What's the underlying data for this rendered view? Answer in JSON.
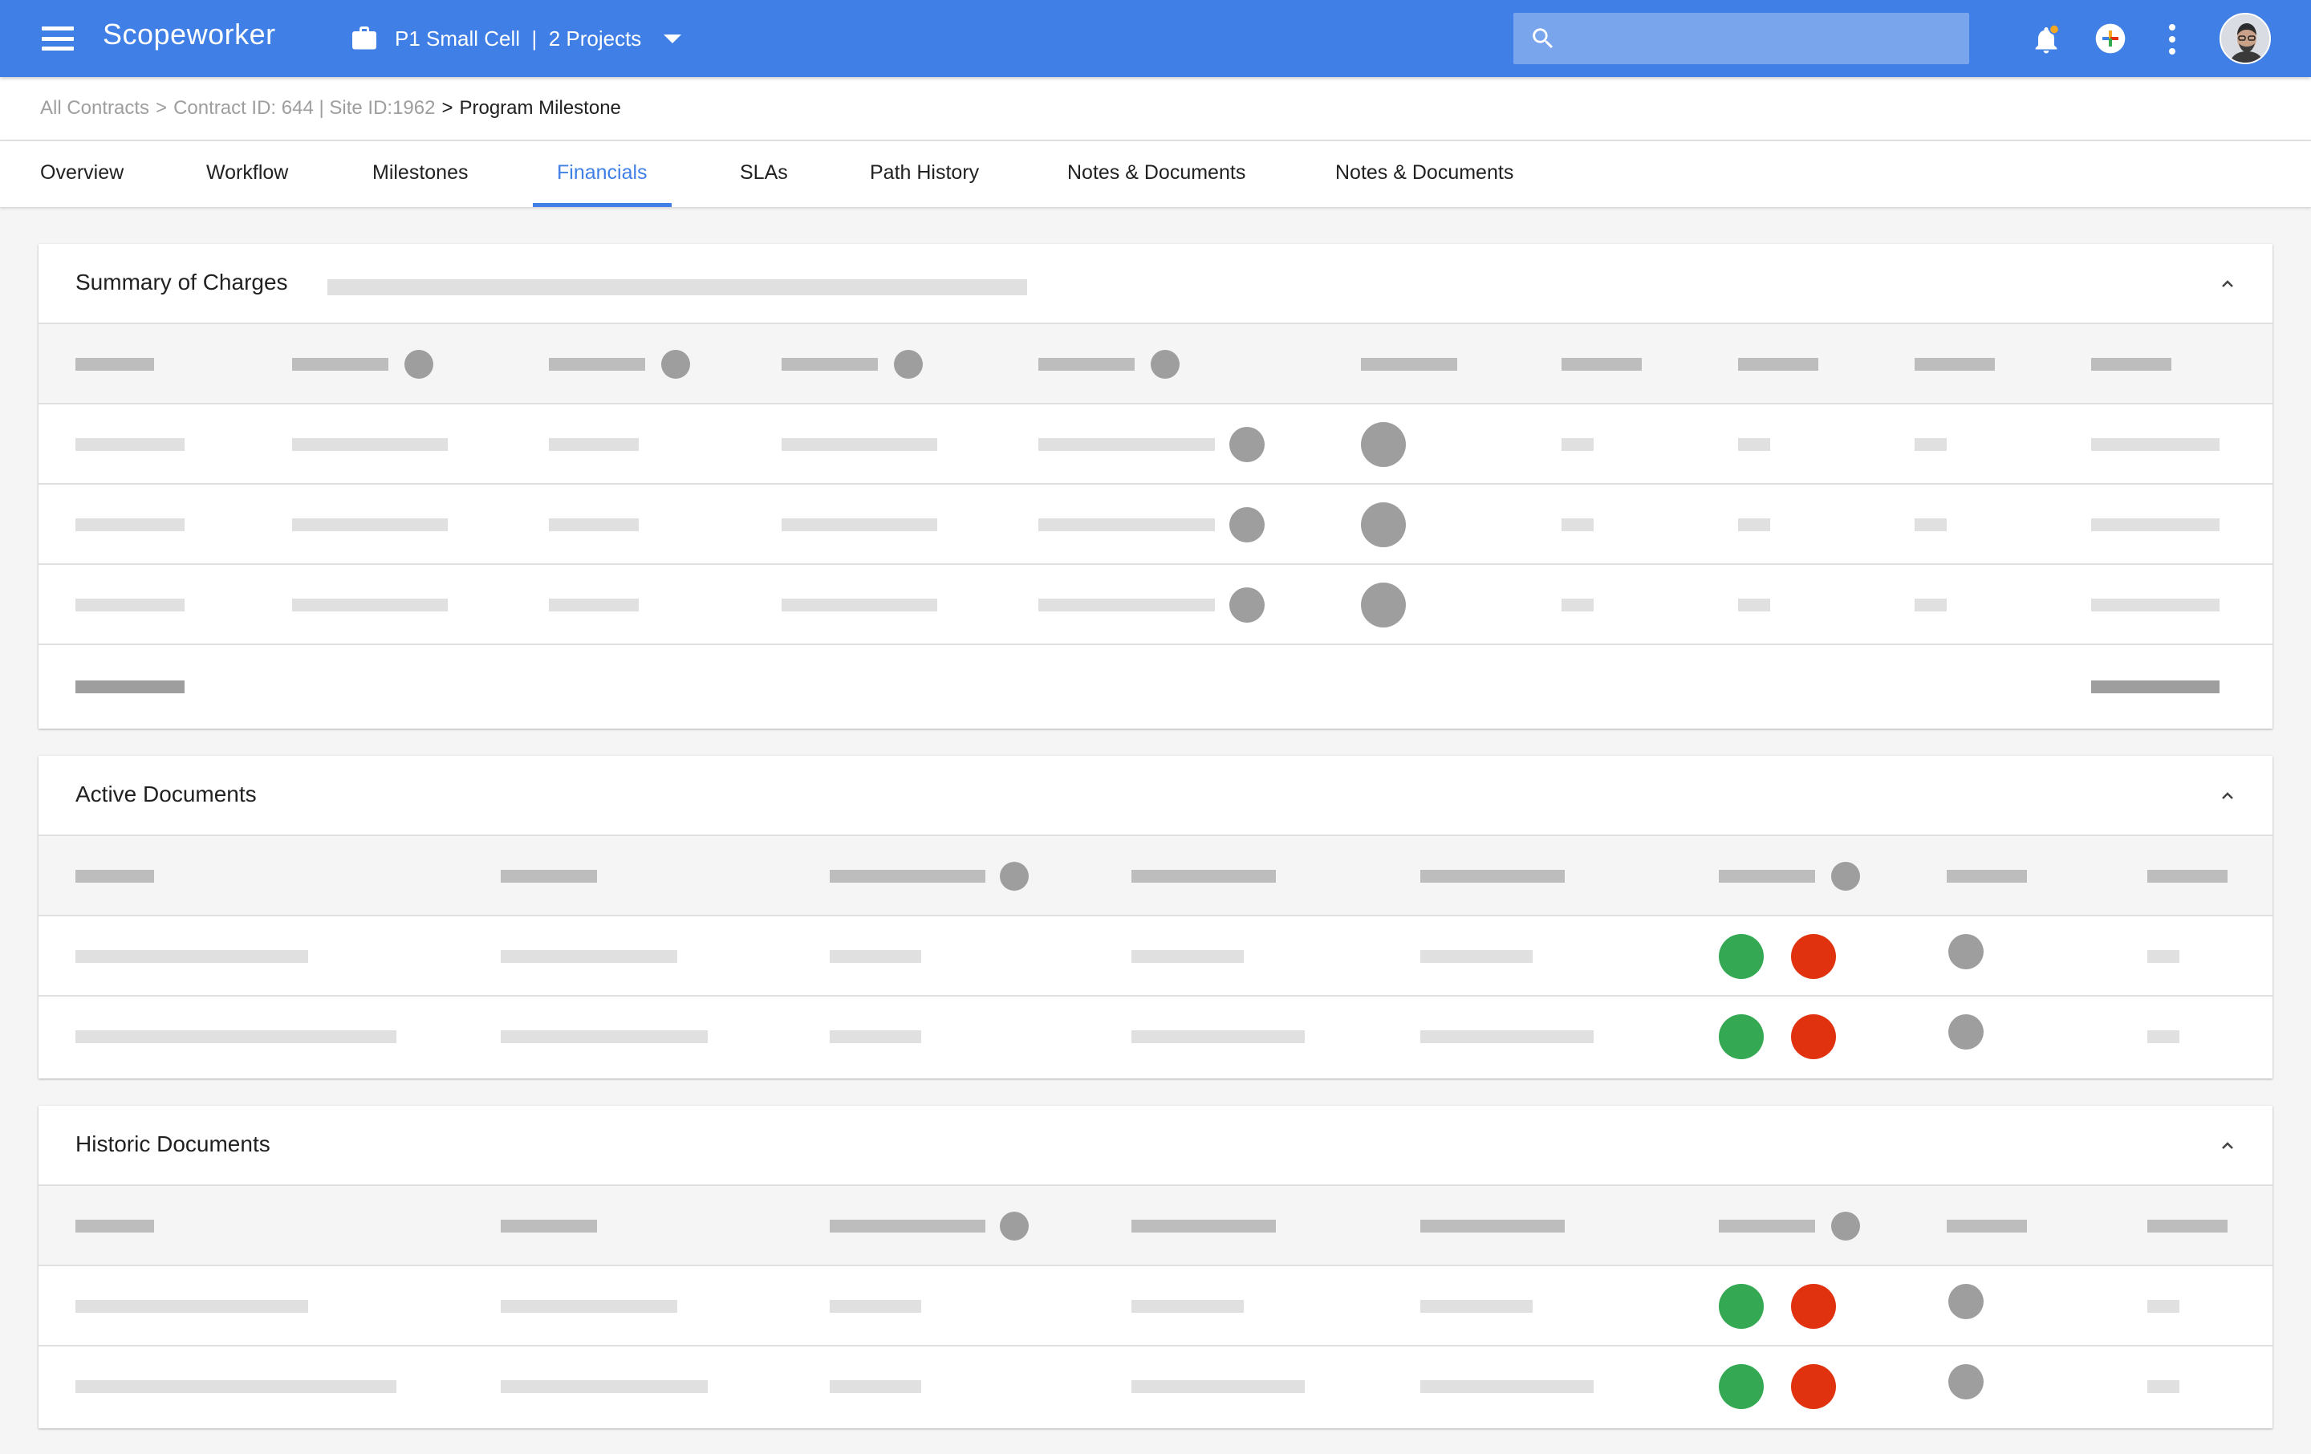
{
  "app": {
    "title": "Scopeworker",
    "project_selector": "P1 Small Cell  |  2 Projects",
    "search_placeholder": ""
  },
  "colors": {
    "brand": "#3f7fe6",
    "status_green": "#34a853",
    "status_red": "#e0320f",
    "notification_badge": "#f5a623"
  },
  "icons": {
    "menu": "menu-icon",
    "briefcase": "briefcase-icon",
    "dropdown": "caret-down-icon",
    "search": "search-icon",
    "notifications": "bell-icon",
    "add": "add-circle-icon",
    "more": "more-vert-icon",
    "collapse": "chevron-up-icon"
  },
  "breadcrumb": {
    "items": [
      "All Contracts",
      "Contract ID: 644 | Site ID:1962"
    ],
    "separator": ">",
    "current": "Program Milestone"
  },
  "tabs": [
    {
      "label": "Overview"
    },
    {
      "label": "Workflow"
    },
    {
      "label": "Milestones"
    },
    {
      "label": "Financials",
      "active": true
    },
    {
      "label": "SLAs"
    },
    {
      "label": "Path History"
    },
    {
      "label": "Notes & Documents"
    },
    {
      "label": "Notes & Documents"
    }
  ],
  "sections": {
    "summary": {
      "title": "Summary of Charges"
    },
    "active": {
      "title": "Active Documents"
    },
    "historic": {
      "title": "Historic Documents"
    }
  }
}
